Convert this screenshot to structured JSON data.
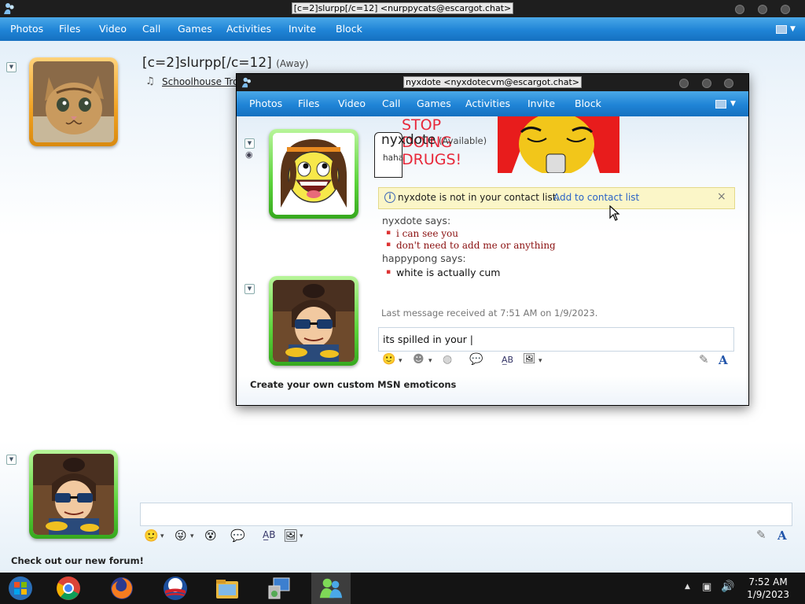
{
  "outer_window": {
    "title": "[c=2]slurpp[/c=12] <nurppycats@escargot.chat>",
    "menu": [
      "Photos",
      "Files",
      "Video",
      "Call",
      "Games",
      "Activities",
      "Invite",
      "Block"
    ],
    "contact_name": "[c=2]slurpp[/c=12]",
    "contact_status": "(Away)",
    "now_playing": "Schoolhouse Tro",
    "footer_link": "Check out our new forum!"
  },
  "inner_window": {
    "title": "nyxdote <nyxdotecvm@escargot.chat>",
    "menu": [
      "Photos",
      "Files",
      "Video",
      "Call",
      "Games",
      "Activities",
      "Invite",
      "Block"
    ],
    "contact_name": "nyxdote",
    "contact_status": "(Available)",
    "personal_message": "haha",
    "banner_text": [
      "STOP",
      "DOING",
      "DRUGS!"
    ],
    "info_bar": {
      "text": "nyxdote is not in your contact list.",
      "link": "Add to contact list"
    },
    "conversation": [
      {
        "sender": "nyxdote says:",
        "lines": [
          "i can see you",
          "don't need to add me or anything"
        ]
      },
      {
        "sender": "happypong says:",
        "lines": [
          "white is actually cum"
        ]
      }
    ],
    "last_message": "Last message received at 7:51 AM on 1/9/2023.",
    "input_value": "its spilled in your",
    "footer_link": "Create your own custom MSN emoticons"
  },
  "taskbar": {
    "time": "7:52 AM",
    "date": "1/9/2023",
    "apps": [
      "windows-start-icon",
      "chrome-icon",
      "firefox-icon",
      "obama-logo-icon",
      "file-explorer-icon",
      "network-app-icon",
      "messenger-icon"
    ]
  },
  "colors": {
    "menu_blue": "#1f84d6",
    "info_bar": "#fbf6c8",
    "link_blue": "#2a62c7",
    "message_red": "#8a0f0f",
    "green_frame": "#5bd33a",
    "orange_frame": "#f0a020"
  }
}
